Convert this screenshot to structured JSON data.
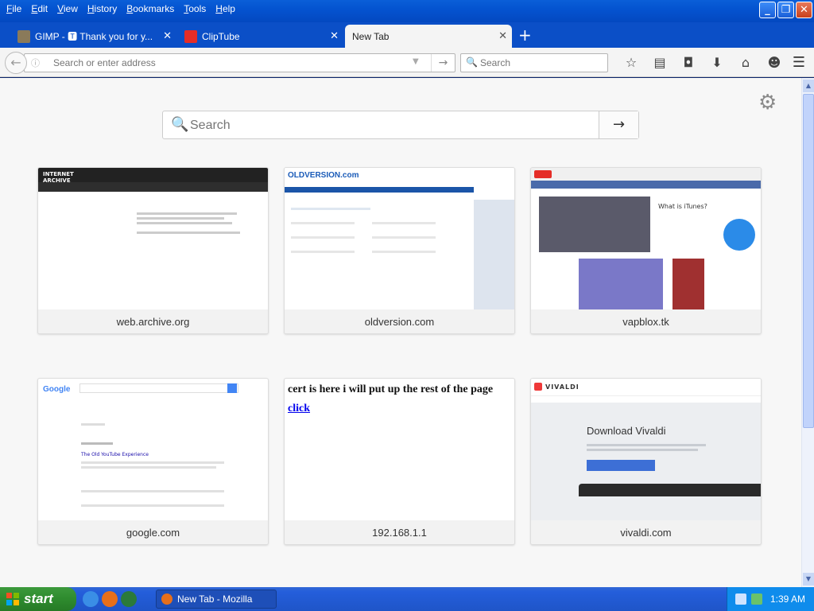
{
  "menu": [
    "File",
    "Edit",
    "View",
    "History",
    "Bookmarks",
    "Tools",
    "Help"
  ],
  "window_controls": {
    "minimize": "_",
    "maximize": "❐",
    "close": "✕"
  },
  "tabs": [
    {
      "label": "GIMP - 🆃 Thank you for y...",
      "icon": "gimp-icon"
    },
    {
      "label": "ClipTube",
      "icon": "youtube-icon"
    },
    {
      "label": "New Tab",
      "icon": "",
      "active": true
    }
  ],
  "toolbar": {
    "url_placeholder": "Search or enter address",
    "search_placeholder": "Search"
  },
  "newtab": {
    "search_placeholder": "Search",
    "tiles": [
      {
        "label": "web.archive.org"
      },
      {
        "label": "oldversion.com"
      },
      {
        "label": "vapblox.tk"
      },
      {
        "label": "google.com"
      },
      {
        "label": "192.168.1.1"
      },
      {
        "label": "vivaldi.com"
      }
    ],
    "thumb_texts": {
      "oldversion_logo": "OLDVERSION.com",
      "google_logo": "Google",
      "google_result": "The Old YouTube Experience",
      "cert_text": "cert is here i will put up the rest of the page",
      "cert_link": "click",
      "vivaldi_logo": "VIVALDI",
      "vivaldi_title": "Download Vivaldi",
      "itunes_title": "What is iTunes?"
    }
  },
  "taskbar": {
    "start_label": "start",
    "task_label": "New Tab - Mozilla Fire...",
    "clock": "1:39 AM"
  }
}
